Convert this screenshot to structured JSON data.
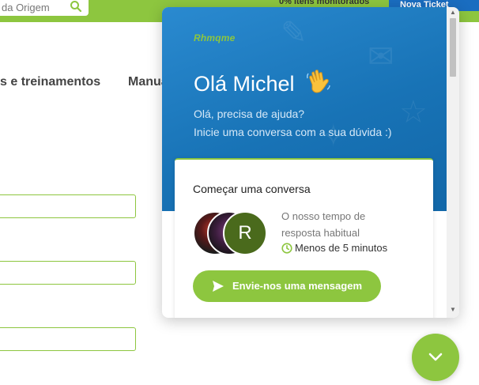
{
  "page": {
    "search": {
      "value": "da Origem",
      "icon": "search-icon"
    },
    "monitored_text": "0% Itens monitorados",
    "new_ticket_label": "Nova Ticket",
    "nav": [
      {
        "label": "s e treinamentos"
      },
      {
        "label": "Manua"
      }
    ]
  },
  "widget": {
    "logo": "R​hmqme",
    "greeting": "Olá Michel",
    "subtext_line1": "Olá, precisa de ajuda?",
    "subtext_line2": "Inicie uma conversa com a sua dúvida :)",
    "card": {
      "title": "Começar uma conversa",
      "avatar_initial": "R",
      "response_line1": "O nosso tempo de",
      "response_line2": "resposta habitual",
      "response_time": "Menos de 5 minutos",
      "send_button": "Envie-nos uma mensagem"
    }
  },
  "colors": {
    "brand_green": "#8dc63f",
    "header_blue": "#1873b6"
  }
}
